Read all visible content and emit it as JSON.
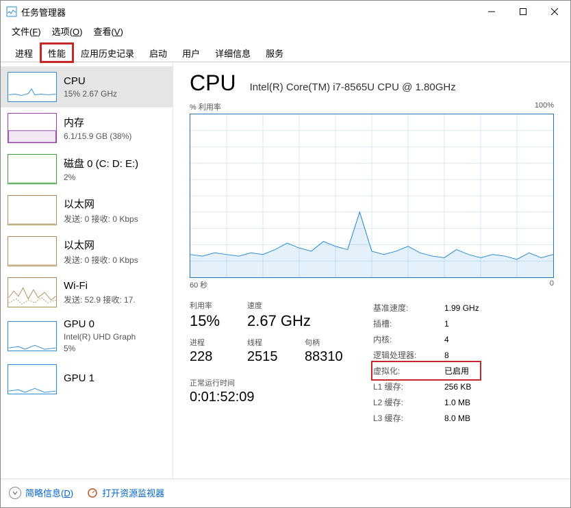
{
  "window": {
    "title": "任务管理器"
  },
  "menubar": [
    {
      "label": "文件",
      "key": "F"
    },
    {
      "label": "选项",
      "key": "O"
    },
    {
      "label": "查看",
      "key": "V"
    }
  ],
  "tabs": [
    "进程",
    "性能",
    "应用历史记录",
    "启动",
    "用户",
    "详细信息",
    "服务"
  ],
  "active_tab": 1,
  "sidebar": [
    {
      "title": "CPU",
      "sub": "15% 2.67 GHz",
      "color": "#2a8dd4",
      "selected": true,
      "kind": "cpu"
    },
    {
      "title": "内存",
      "sub": "6.1/15.9 GB (38%)",
      "color": "#9b3fae",
      "kind": "mem"
    },
    {
      "title": "磁盘 0 (C: D: E:)",
      "sub": "2%",
      "color": "#3a9b3a",
      "kind": "disk"
    },
    {
      "title": "以太网",
      "sub": "发送: 0 接收: 0 Kbps",
      "color": "#b08d57",
      "kind": "eth"
    },
    {
      "title": "以太网",
      "sub": "发送: 0 接收: 0 Kbps",
      "color": "#b08d57",
      "kind": "eth"
    },
    {
      "title": "Wi-Fi",
      "sub": "发送: 52.9 接收: 17.",
      "color": "#b08d57",
      "kind": "wifi"
    },
    {
      "title": "GPU 0",
      "sub": "Intel(R) UHD Graph",
      "sub2": "5%",
      "color": "#2a8dd4",
      "kind": "gpu"
    },
    {
      "title": "GPU 1",
      "sub": "",
      "color": "#2a8dd4",
      "kind": "gpu"
    }
  ],
  "detail": {
    "title": "CPU",
    "model": "Intel(R) Core(TM) i7-8565U CPU @ 1.80GHz",
    "chart_top_left": "% 利用率",
    "chart_top_right": "100%",
    "chart_bottom_left": "60 秒",
    "chart_bottom_right": "0",
    "big_stats": [
      {
        "label": "利用率",
        "value": "15%"
      },
      {
        "label": "速度",
        "value": "2.67 GHz"
      }
    ],
    "small_stats": [
      {
        "label": "进程",
        "value": "228"
      },
      {
        "label": "线程",
        "value": "2515"
      },
      {
        "label": "句柄",
        "value": "88310"
      }
    ],
    "uptime_label": "正常运行时间",
    "uptime_value": "0:01:52:09",
    "right_stats": [
      {
        "label": "基准速度:",
        "value": "1.99 GHz"
      },
      {
        "label": "插槽:",
        "value": "1"
      },
      {
        "label": "内核:",
        "value": "4"
      },
      {
        "label": "逻辑处理器:",
        "value": "8"
      },
      {
        "label": "虚拟化:",
        "value": "已启用",
        "highlight": true
      },
      {
        "label": "L1 缓存:",
        "value": "256 KB"
      },
      {
        "label": "L2 缓存:",
        "value": "1.0 MB"
      },
      {
        "label": "L3 缓存:",
        "value": "8.0 MB"
      }
    ]
  },
  "footer": {
    "brief": "简略信息",
    "brief_key": "D",
    "monitor": "打开资源监视器"
  },
  "chart_data": {
    "type": "line",
    "title": "% 利用率",
    "xlabel": "60 秒 → 0",
    "ylabel": "%",
    "ylim": [
      0,
      100
    ],
    "x": [
      0,
      2,
      4,
      6,
      8,
      10,
      12,
      14,
      16,
      18,
      20,
      22,
      24,
      26,
      28,
      30,
      32,
      34,
      36,
      38,
      40,
      42,
      44,
      46,
      48,
      50,
      52,
      54,
      56,
      58,
      60
    ],
    "values": [
      14,
      13,
      15,
      14,
      13,
      15,
      14,
      17,
      21,
      18,
      16,
      22,
      19,
      17,
      40,
      16,
      14,
      16,
      19,
      15,
      13,
      12,
      17,
      14,
      12,
      14,
      13,
      11,
      15,
      12,
      14
    ]
  }
}
